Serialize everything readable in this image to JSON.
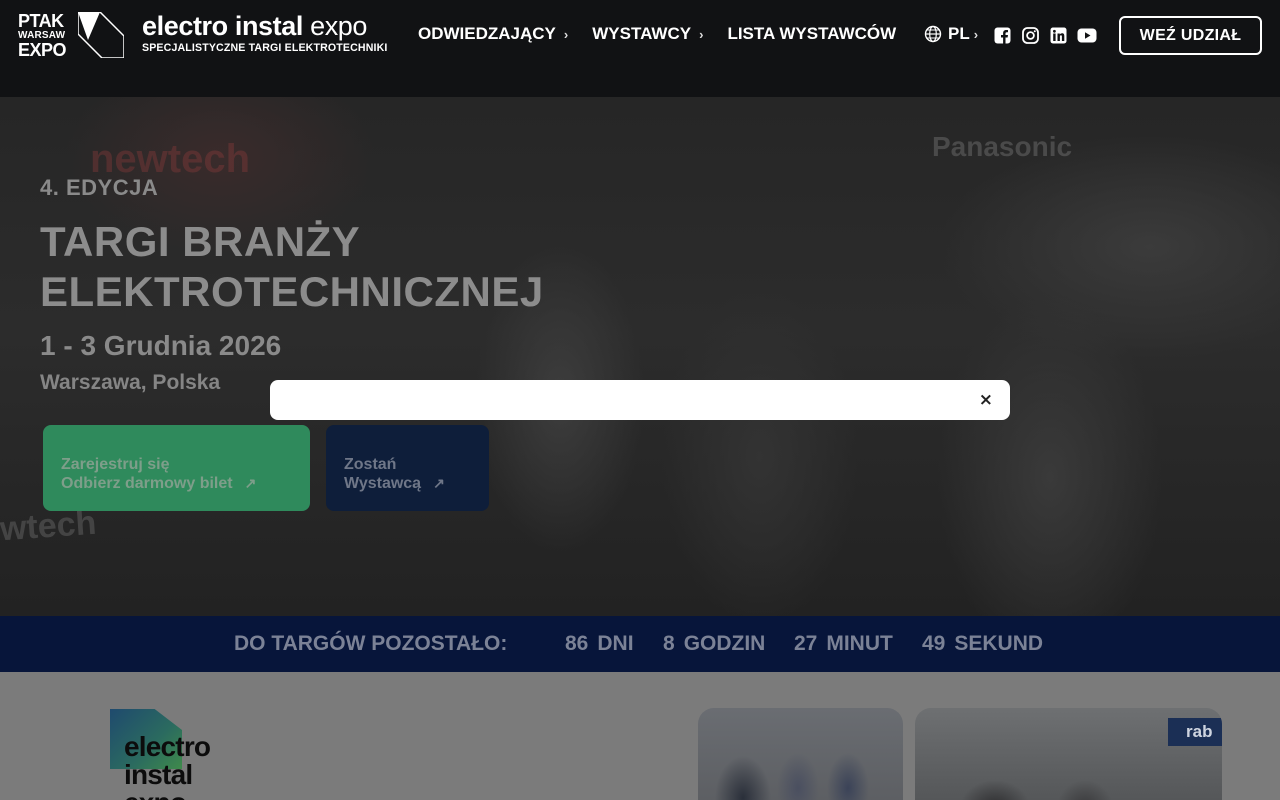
{
  "header": {
    "ptak_logo": [
      "PTAK",
      "WARSAW",
      "EXPO"
    ],
    "brand_bold": "electro instal",
    "brand_light": "expo",
    "brand_sub": "SPECJALISTYCZNE TARGI ELEKTROTECHNIKI",
    "nav": [
      {
        "label": "ODWIEDZAJĄCY",
        "has_chevron": true
      },
      {
        "label": "WYSTAWCY",
        "has_chevron": true
      },
      {
        "label": "LISTA WYSTAWCÓW",
        "has_chevron": false
      }
    ],
    "lang": "PL",
    "social_icons": [
      "facebook-icon",
      "instagram-icon",
      "linkedin-icon",
      "youtube-icon"
    ],
    "cta_label": "WEŹ UDZIAŁ"
  },
  "hero": {
    "edition": "4. EDYCJA",
    "headline_l1": "TARGI BRANŻY",
    "headline_l2": "ELEKTROTECHNICZNEJ",
    "dates": "1 - 3 Grudnia 2026",
    "place": "Warszawa, Polska",
    "btn_register_l1": "Zarejestruj się",
    "btn_register_l2": "Odbierz darmowy bilet",
    "btn_exhib_l1": "Zostań",
    "btn_exhib_l2": "Wystawcą",
    "arrow_glyph": "↗",
    "bg_text": [
      "newtech",
      "Panasonic",
      "wtech"
    ]
  },
  "modal": {
    "close_glyph": "×"
  },
  "countdown": {
    "label": "DO TARGÓW POZOSTAŁO:",
    "units": [
      {
        "value": "86",
        "unit": "DNI"
      },
      {
        "value": "8",
        "unit": "GODZIN"
      },
      {
        "value": "27",
        "unit": "MINUT"
      },
      {
        "value": "49",
        "unit": "SEKUND"
      }
    ]
  },
  "bottom": {
    "logo_lines": [
      "electro",
      "instal",
      "expo"
    ],
    "photo_badge": "rab"
  },
  "colors": {
    "header_bg": "#111214",
    "register_green": "#2f8a5c",
    "exhibitor_navy": "#0e1e3a",
    "countdown_bg": "#07153a"
  }
}
